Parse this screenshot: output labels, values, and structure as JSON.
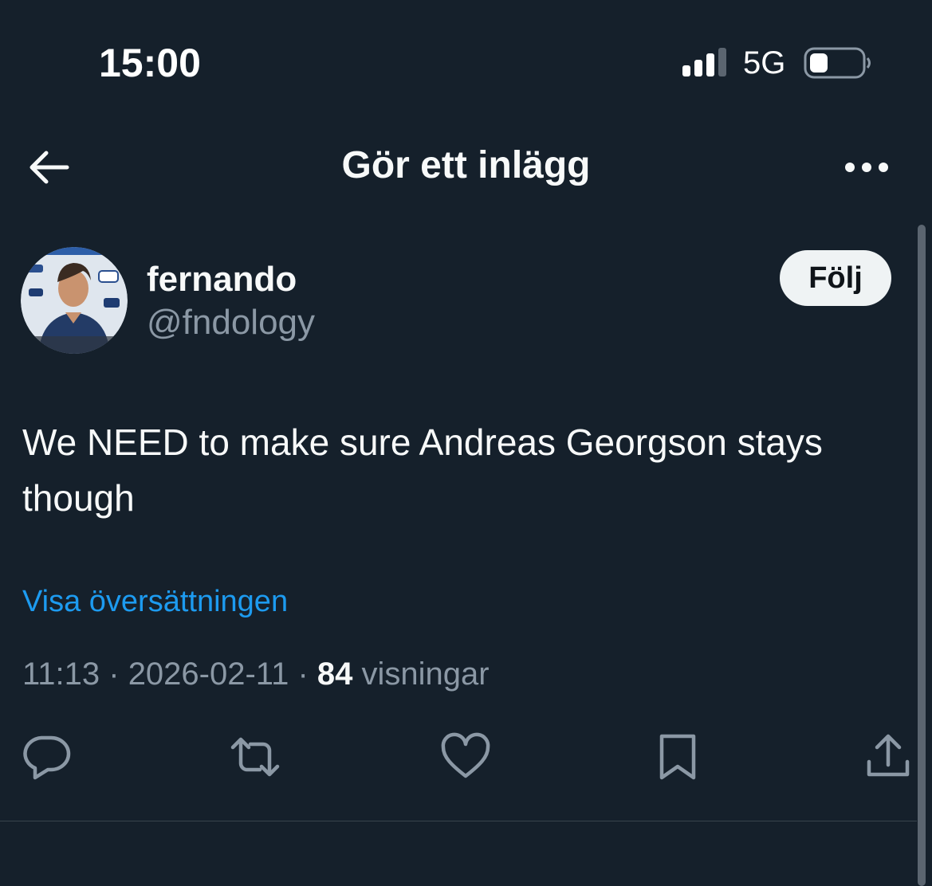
{
  "status_bar": {
    "time": "15:00",
    "network": "5G",
    "icons": [
      "signal-icon",
      "battery-icon"
    ]
  },
  "header": {
    "title": "Gör ett inlägg",
    "back_icon": "arrow-left-icon",
    "more_icon": "more-horizontal-icon"
  },
  "post": {
    "author": {
      "name": "fernando",
      "handle": "@fndology",
      "avatar_icon": "profile-photo"
    },
    "follow_label": "Följ",
    "text": "We NEED to make sure Andreas Georgson stays though",
    "translate_label": "Visa översättningen",
    "meta": {
      "time": "11:13",
      "separator": " · ",
      "date": "2026-02-11",
      "views_count": "84",
      "views_label": " visningar"
    },
    "actions": [
      "reply-icon",
      "repost-icon",
      "like-icon",
      "bookmark-icon",
      "share-icon"
    ]
  },
  "next_section": {
    "heading": ""
  },
  "colors": {
    "background": "#15202b",
    "text_primary": "#f7f9f9",
    "text_secondary": "#8b98a5",
    "link": "#1d9bf0",
    "divider": "#38444d",
    "follow_bg": "#eff3f4"
  }
}
